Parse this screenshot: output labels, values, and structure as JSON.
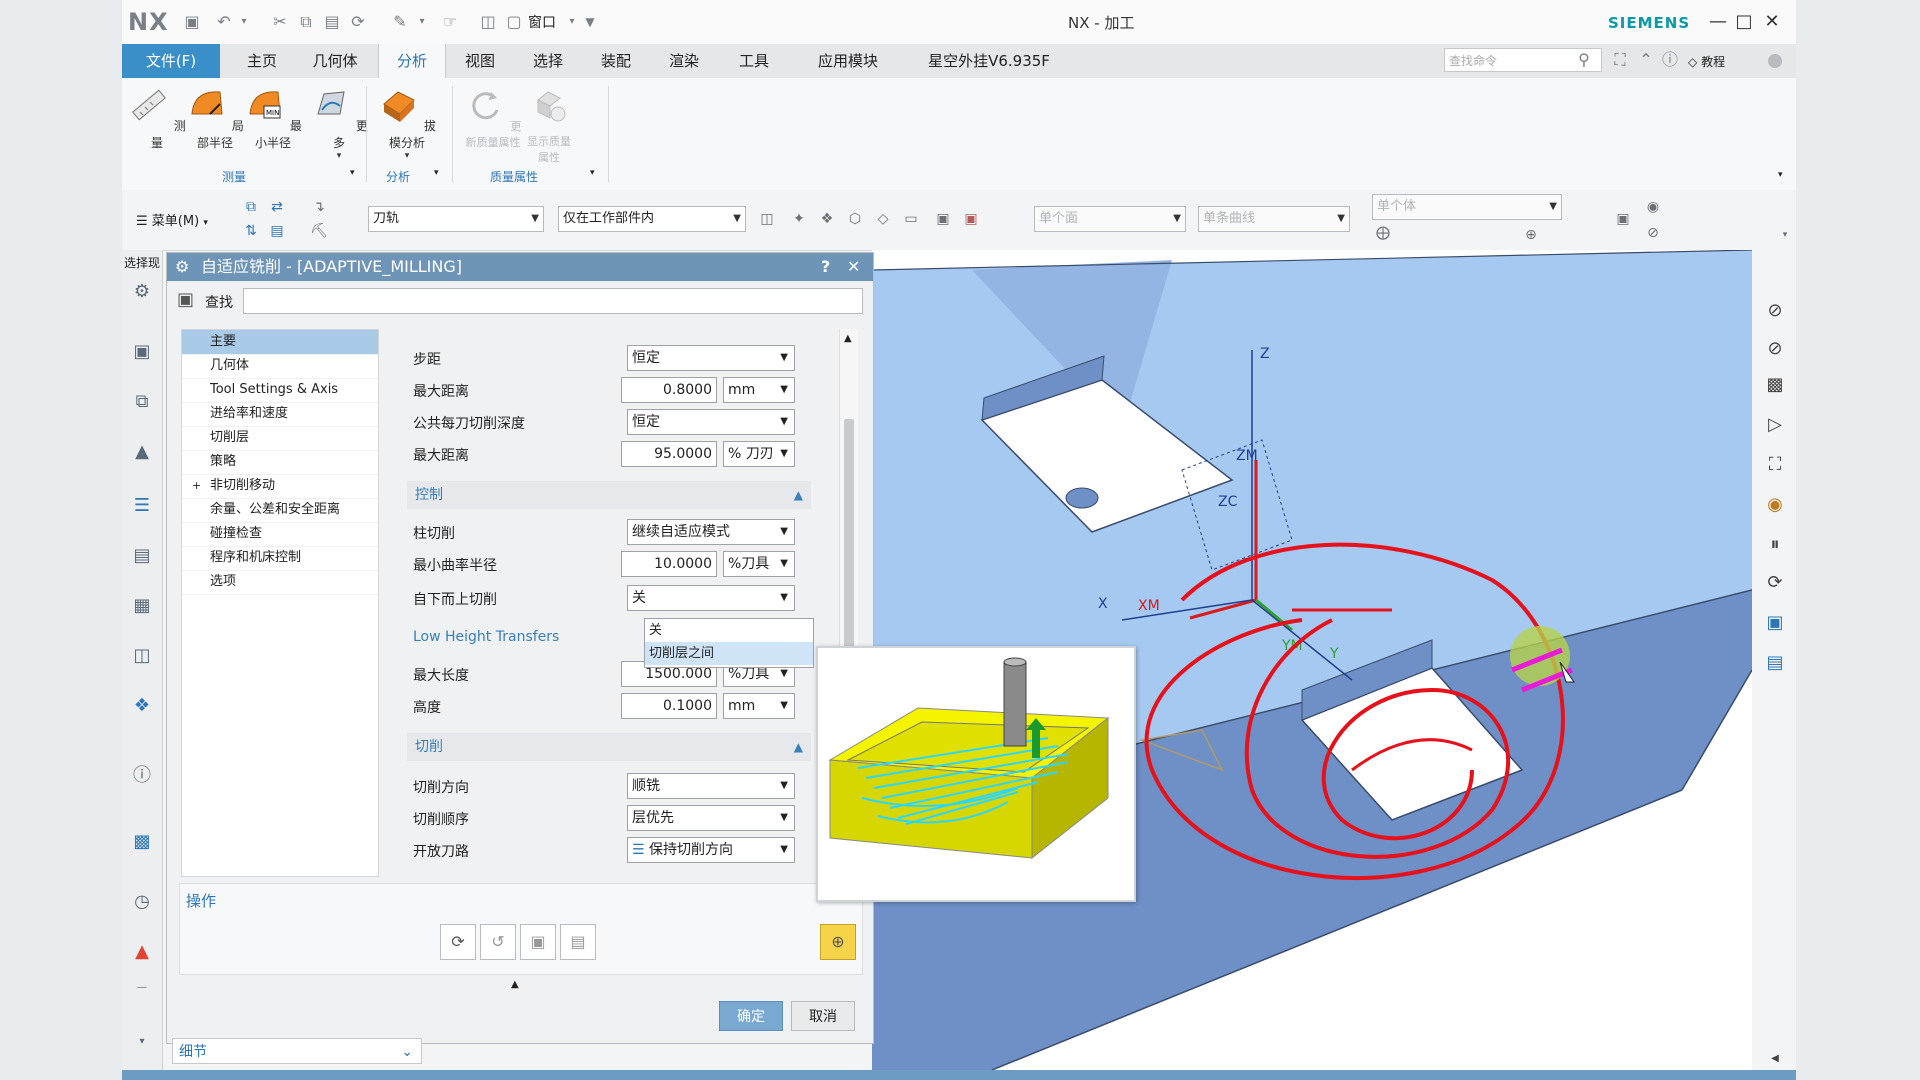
{
  "title_bar": {
    "logo": "NX",
    "window_title": "NX - 加工",
    "brand": "SIEMENS",
    "window_menu_label": "窗口"
  },
  "menu": {
    "file_tab": "文件(F)",
    "tabs": [
      "主页",
      "几何体",
      "分析",
      "视图",
      "选择",
      "装配",
      "渲染",
      "工具",
      "应用模块",
      "星空外挂V6.935F"
    ],
    "active_tab": "分析",
    "search_placeholder": "查找命令",
    "tutorial_label": "教程"
  },
  "ribbon": {
    "buttons": [
      {
        "label": "测量",
        "icon": "ruler-icon"
      },
      {
        "label": "局部半径",
        "icon": "local-radius-icon"
      },
      {
        "label": "最小半径",
        "icon": "min-radius-icon"
      },
      {
        "label": "更多",
        "icon": "more-icon"
      },
      {
        "label": "拔模分析",
        "icon": "draft-analysis-icon"
      },
      {
        "label": "更新质量属性",
        "icon": "update-mass-icon"
      },
      {
        "label": "显示质量属性",
        "icon": "show-mass-icon"
      }
    ],
    "groups": [
      "测量",
      "分析",
      "质量属性"
    ]
  },
  "selection_bar": {
    "menu_label": "菜单(M)",
    "filter_type": "刀轨",
    "scope": "仅在工作部件内",
    "face_rule": "单个面",
    "curve_rule": "单条曲线",
    "body_rule": "单个体"
  },
  "resource_bar": {
    "label": "选择现"
  },
  "dialog": {
    "title": "自适应铣削 - [ADAPTIVE_MILLING]",
    "help": "?",
    "find_label": "查找",
    "tree": [
      "主要",
      "几何体",
      "Tool Settings & Axis",
      "进给率和速度",
      "切削层",
      "策略",
      "非切削移动",
      "余量、公差和安全距离",
      "碰撞检查",
      "程序和机床控制",
      "选项"
    ],
    "selected_tree_item": "主要",
    "params": {
      "stepover_label": "步距",
      "stepover_value": "恒定",
      "max_distance_label": "最大距离",
      "max_distance_value": "0.8000",
      "max_distance_unit": "mm",
      "common_depth_label": "公共每刀切削深度",
      "common_depth_value": "恒定",
      "max_distance2_label": "最大距离",
      "max_distance2_value": "95.0000",
      "max_distance2_unit": "% 刀刃"
    },
    "control_section": {
      "title": "控制",
      "pillar_cut_label": "柱切削",
      "pillar_cut_value": "继续自适应模式",
      "min_radius_label": "最小曲率半径",
      "min_radius_value": "10.0000",
      "min_radius_unit": "%刀具",
      "bottom_up_label": "自下而上切削",
      "bottom_up_value": "关",
      "dropdown_options": [
        "关",
        "切削层之间"
      ],
      "highlighted_option": "切削层之间"
    },
    "low_height_section": {
      "title": "Low Height Transfers",
      "max_length_label": "最大长度",
      "max_length_value": "1500.000",
      "max_length_unit": "%刀具",
      "height_label": "高度",
      "height_value": "0.1000",
      "height_unit": "mm"
    },
    "cut_section": {
      "title": "切削",
      "direction_label": "切削方向",
      "direction_value": "顺铣",
      "order_label": "切削顺序",
      "order_value": "层优先",
      "open_path_label": "开放刀路",
      "open_path_value": "保持切削方向"
    },
    "operations_label": "操作",
    "ok": "确定",
    "cancel": "取消",
    "details_label": "细节"
  },
  "viewport": {
    "axes_labels": [
      "ZM",
      "Z",
      "ZC",
      "XM",
      "X",
      "YM",
      "Y"
    ],
    "colors": {
      "part_top": "#a6c9f2",
      "part_side": "#6f8fc7",
      "annotation": "#e5121c",
      "tool_marker": "#e81bd6"
    }
  }
}
